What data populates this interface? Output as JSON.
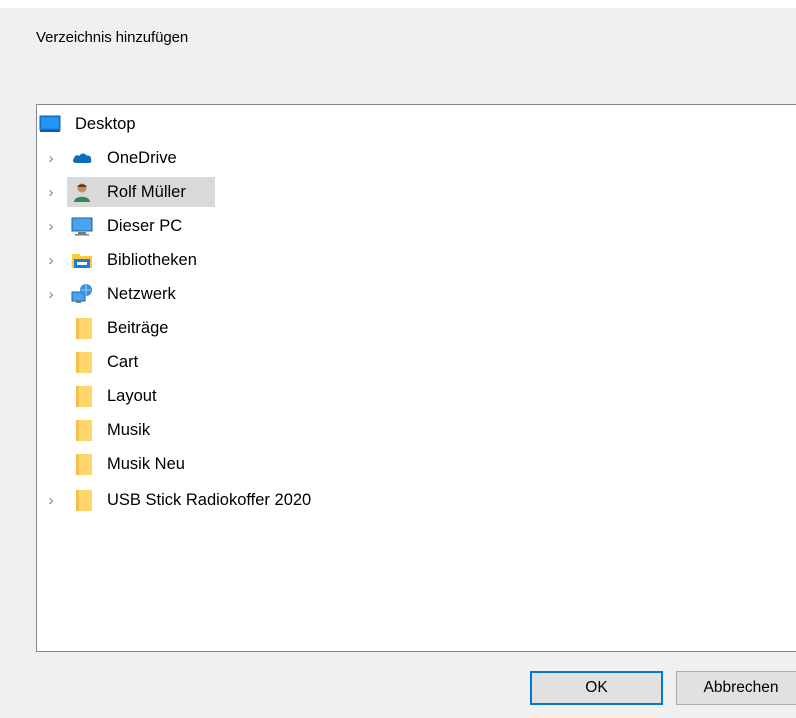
{
  "dialog": {
    "prompt": "Verzeichnis hinzufügen",
    "ok_label": "OK",
    "cancel_label": "Abbrechen"
  },
  "tree": {
    "root": {
      "label": "Desktop",
      "icon": "desktop-icon"
    },
    "items": [
      {
        "label": "OneDrive",
        "icon": "cloud-icon",
        "expandable": true,
        "selected": false
      },
      {
        "label": "Rolf Müller",
        "icon": "user-icon",
        "expandable": true,
        "selected": true
      },
      {
        "label": "Dieser PC",
        "icon": "computer-icon",
        "expandable": true,
        "selected": false
      },
      {
        "label": "Bibliotheken",
        "icon": "library-icon",
        "expandable": true,
        "selected": false
      },
      {
        "label": "Netzwerk",
        "icon": "network-icon",
        "expandable": true,
        "selected": false
      },
      {
        "label": "Beiträge",
        "icon": "folder-icon",
        "expandable": false,
        "selected": false
      },
      {
        "label": "Cart",
        "icon": "folder-icon",
        "expandable": false,
        "selected": false
      },
      {
        "label": "Layout",
        "icon": "folder-icon",
        "expandable": false,
        "selected": false
      },
      {
        "label": "Musik",
        "icon": "folder-icon",
        "expandable": false,
        "selected": false
      },
      {
        "label": "Musik Neu",
        "icon": "folder-icon",
        "expandable": false,
        "selected": false
      },
      {
        "label": "USB Stick Radiokoffer 2020",
        "icon": "folder-icon",
        "expandable": true,
        "selected": false
      }
    ]
  },
  "colors": {
    "selection": "#d9d9d9",
    "ok_border": "#0078d7",
    "folder": "#ffd66b",
    "onedrive": "#0f6cbd"
  }
}
